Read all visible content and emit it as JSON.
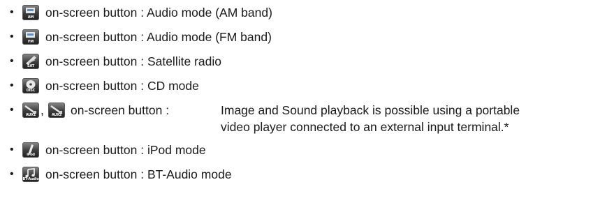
{
  "bullet": "•",
  "items": [
    {
      "icon_name": "am-radio-icon",
      "icon_tag": "AM",
      "prefix": "on-screen button :",
      "text": "Audio mode (AM band)"
    },
    {
      "icon_name": "fm-radio-icon",
      "icon_tag": "FM",
      "prefix": "on-screen button :",
      "text": "Audio mode (FM band)"
    },
    {
      "icon_name": "satellite-radio-icon",
      "icon_tag": "SAT",
      "prefix": "on-screen button :",
      "text": "Satellite radio"
    },
    {
      "icon_name": "disc-icon",
      "icon_tag": "DISC",
      "prefix": "on-screen button :",
      "text": "CD mode"
    },
    {
      "icon_name": "aux1-icon",
      "icon_tag": "AUX1",
      "icon2_name": "aux2-icon",
      "icon2_tag": "AUX2",
      "separator": ",",
      "prefix": "on-screen button :",
      "text": "Image and Sound playback is possible using a portable",
      "text_cont": "video player connected to an external input terminal.*"
    },
    {
      "icon_name": "ipod-icon",
      "icon_tag": "iPod",
      "prefix": "on-screen button :",
      "text": "iPod mode"
    },
    {
      "icon_name": "bt-audio-icon",
      "icon_tag": "BT-Audio",
      "prefix": "on-screen button :",
      "text": "BT-Audio mode"
    }
  ]
}
